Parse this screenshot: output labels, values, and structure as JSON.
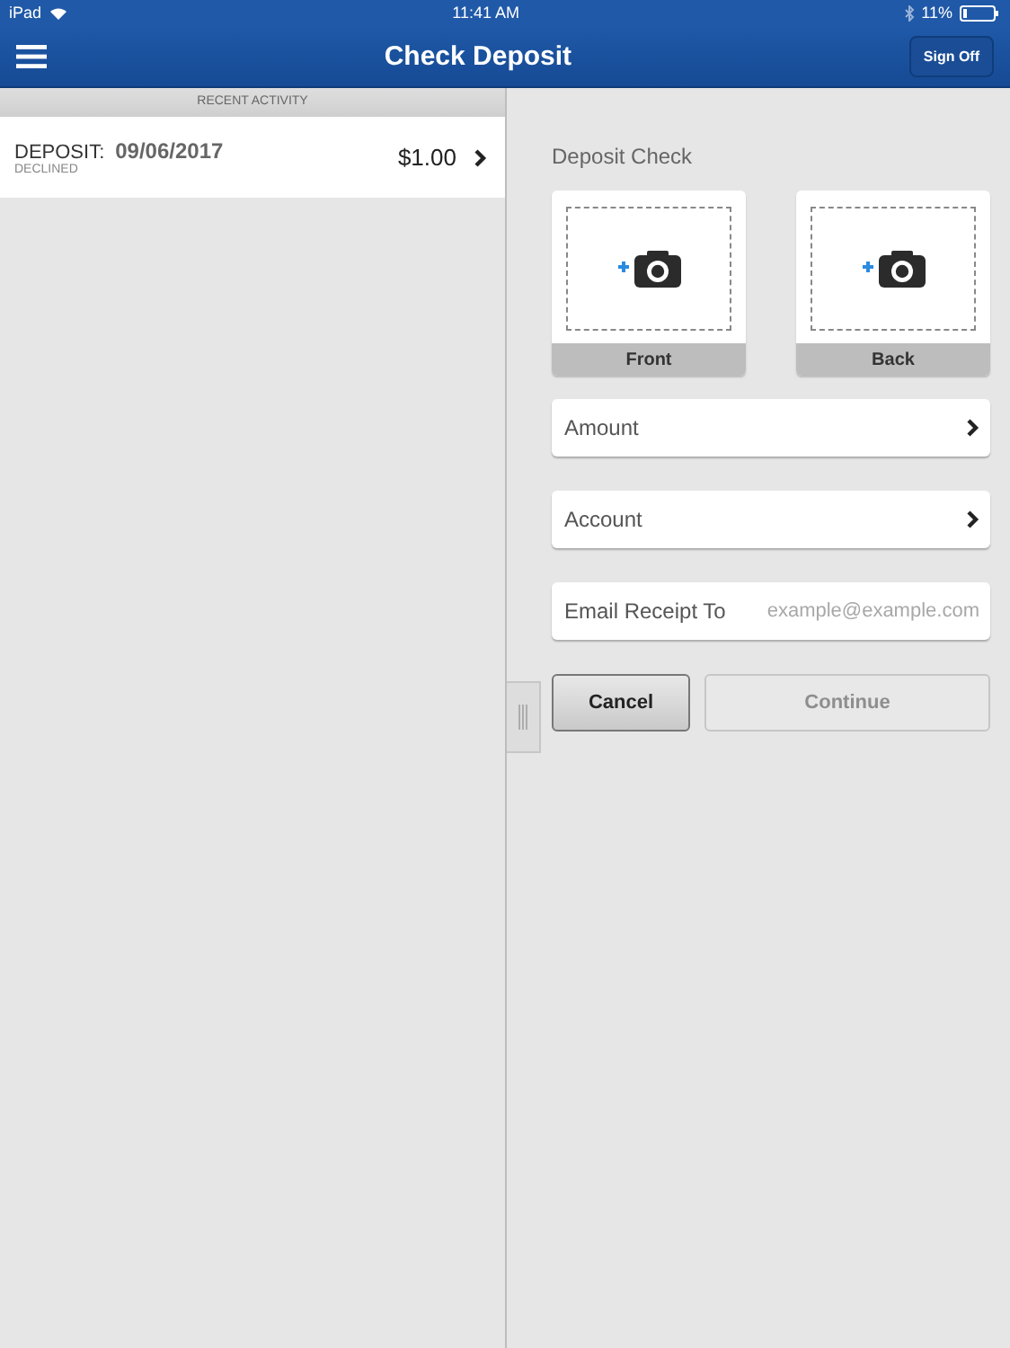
{
  "status_bar": {
    "device": "iPad",
    "time": "11:41 AM",
    "battery": "11%"
  },
  "nav": {
    "title": "Check Deposit",
    "sign_off": "Sign Off"
  },
  "recent_activity": {
    "header": "RECENT ACTIVITY",
    "items": [
      {
        "type": "DEPOSIT:",
        "date": "09/06/2017",
        "status": "DECLINED",
        "amount": "$1.00"
      }
    ]
  },
  "deposit": {
    "title": "Deposit Check",
    "photos": [
      {
        "label": "Front"
      },
      {
        "label": "Back"
      }
    ],
    "fields": [
      {
        "kind": "select",
        "label": "Amount"
      },
      {
        "kind": "select",
        "label": "Account"
      },
      {
        "kind": "email",
        "label": "Email Receipt To",
        "placeholder": "example@example.com"
      }
    ],
    "buttons": [
      {
        "label": "Cancel",
        "disabled": false
      },
      {
        "label": "Continue",
        "disabled": true
      }
    ]
  }
}
